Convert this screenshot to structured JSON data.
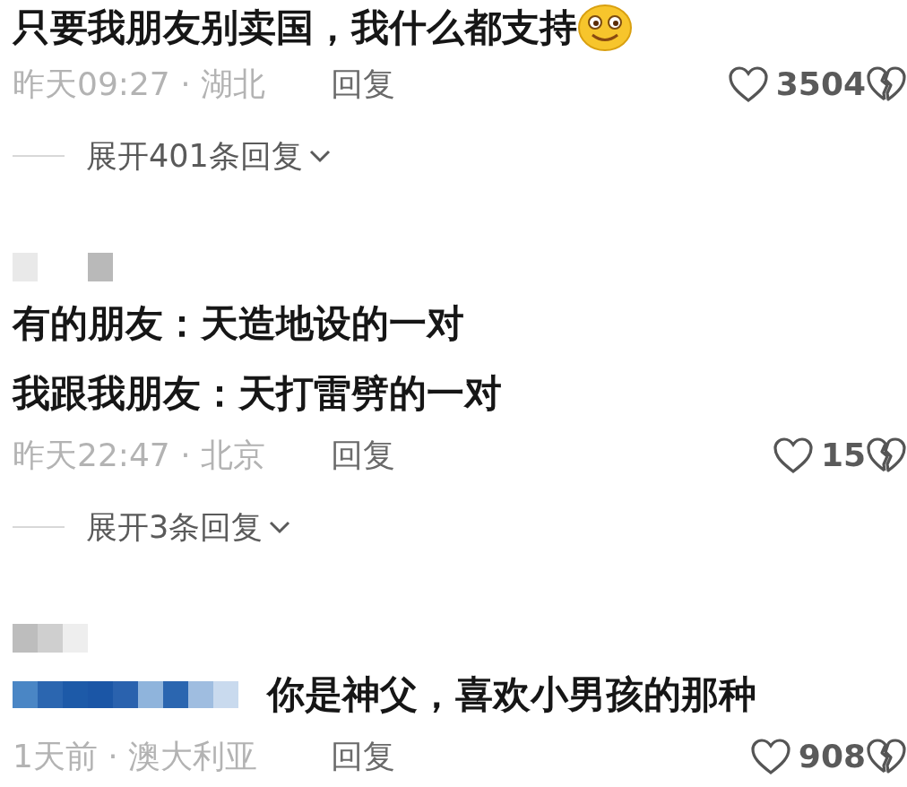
{
  "comments": [
    {
      "name_mosaic": false,
      "mention_mosaic": false,
      "lines": [
        "只要我朋友别卖国，我什么都支持"
      ],
      "emoji": true,
      "meta": "昨天09:27 · 湖北",
      "reply": "回复",
      "likes": "3504",
      "expand": "展开401条回复"
    },
    {
      "name_mosaic": true,
      "mention_mosaic": false,
      "lines": [
        "有的朋友：天造地设的一对",
        "我跟我朋友：天打雷劈的一对"
      ],
      "emoji": false,
      "meta": "昨天22:47 · 北京",
      "reply": "回复",
      "likes": "15",
      "expand": "展开3条回复"
    },
    {
      "name_mosaic": true,
      "mention_mosaic": true,
      "lines": [
        "你是神父，喜欢小男孩的那种"
      ],
      "emoji": false,
      "meta": "1天前 · 澳大利亚",
      "reply": "回复",
      "likes": "908"
    }
  ]
}
